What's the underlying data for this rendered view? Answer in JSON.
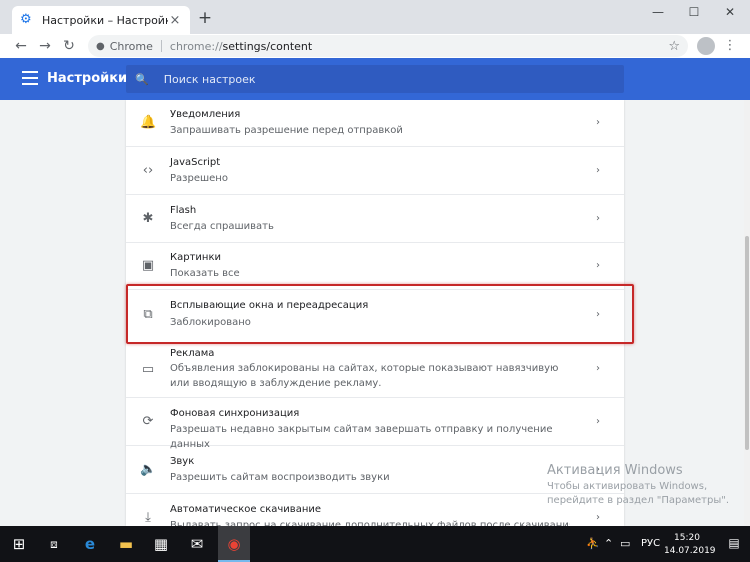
{
  "browser": {
    "tab_title": "Настройки – Настройки сайта",
    "tab_close": "×",
    "new_tab": "+",
    "window_controls": {
      "minimize": "—",
      "maximize": "☐",
      "close": "✕"
    },
    "nav": {
      "back": "←",
      "forward": "→",
      "reload": "↻"
    },
    "omnibox": {
      "scheme_label": "Chrome",
      "url_scheme": "chrome://",
      "url_path": "settings/content"
    },
    "star": "☆",
    "menu": "⋮"
  },
  "settings_header": {
    "title": "Настройки",
    "search_placeholder": "Поиск настроек",
    "accent": "#3367d6"
  },
  "rows": [
    {
      "icon": "bell-icon",
      "glyph": "🔔",
      "title": "Уведомления",
      "subtitle": "Запрашивать разрешение перед отправкой"
    },
    {
      "icon": "code-icon",
      "glyph": "‹›",
      "title": "JavaScript",
      "subtitle": "Разрешено"
    },
    {
      "icon": "puzzle-icon",
      "glyph": "✱",
      "title": "Flash",
      "subtitle": "Всегда спрашивать"
    },
    {
      "icon": "image-icon",
      "glyph": "▣",
      "title": "Картинки",
      "subtitle": "Показать все"
    },
    {
      "icon": "open-external-icon",
      "glyph": "⧉",
      "title": "Всплывающие окна и переадресация",
      "subtitle": "Заблокировано"
    },
    {
      "icon": "ad-window-icon",
      "glyph": "▭",
      "title": "Реклама",
      "subtitle": "Объявления заблокированы на сайтах, которые показывают навязчивую или вводящую в заблуждение рекламу."
    },
    {
      "icon": "sync-icon",
      "glyph": "⟳",
      "title": "Фоновая синхронизация",
      "subtitle": "Разрешать недавно закрытым сайтам завершать отправку и получение данных"
    },
    {
      "icon": "sound-icon",
      "glyph": "🔈",
      "title": "Звук",
      "subtitle": "Разрешить сайтам воспроизводить звуки"
    },
    {
      "icon": "download-icon",
      "glyph": "⤓",
      "title": "Автоматическое скачивание",
      "subtitle": "Выдавать запрос на скачивание дополнительных файлов после скачивания первого"
    }
  ],
  "chevron": "›",
  "highlight_color": "#c62828",
  "watermark": {
    "title": "Активация Windows",
    "line1": "Чтобы активировать Windows,",
    "line2": "перейдите в раздел \"Параметры\"."
  },
  "taskbar": {
    "lang": "РУС",
    "time": "15:20",
    "date": "14.07.2019"
  }
}
